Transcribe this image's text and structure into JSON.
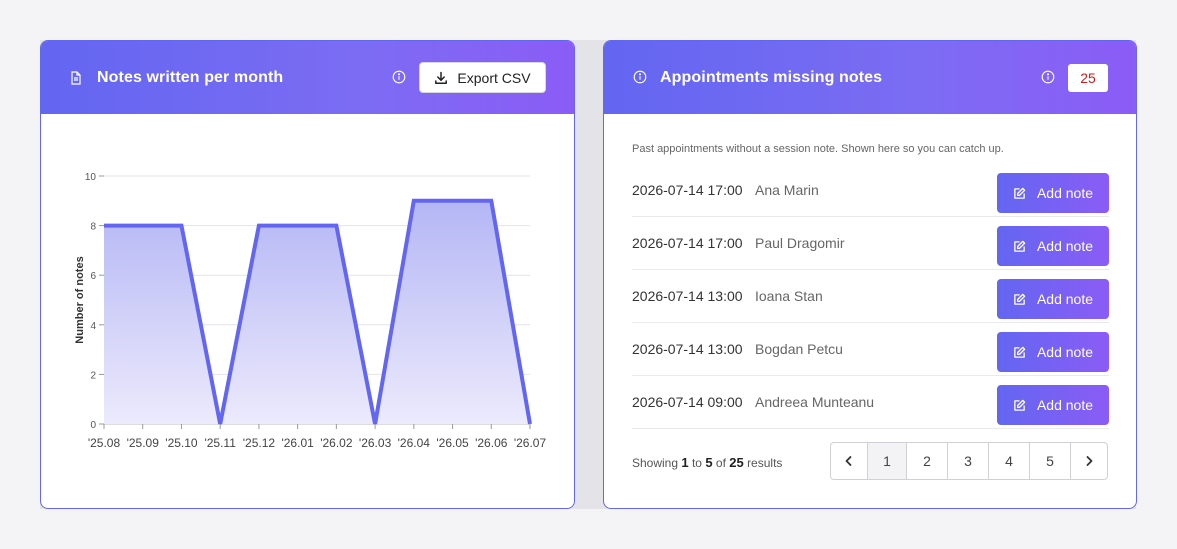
{
  "left_card": {
    "title": "Notes written per month",
    "export_label": "Export CSV"
  },
  "right_card": {
    "title": "Appointments missing notes",
    "count": "25",
    "subtitle": "Past appointments without a session note. Shown here so you can catch up.",
    "add_label": "Add note",
    "rows": [
      {
        "date": "2026-07-14 17:00",
        "name": "Ana Marin"
      },
      {
        "date": "2026-07-14 17:00",
        "name": "Paul Dragomir"
      },
      {
        "date": "2026-07-14 13:00",
        "name": "Ioana Stan"
      },
      {
        "date": "2026-07-14 13:00",
        "name": "Bogdan Petcu"
      },
      {
        "date": "2026-07-14 09:00",
        "name": "Andreea Munteanu"
      }
    ],
    "pagination": {
      "prefix": "Showing",
      "from": "1",
      "to_word": "to",
      "to": "5",
      "of_word": "of",
      "total": "25",
      "suffix": "results",
      "pages": [
        "1",
        "2",
        "3",
        "4",
        "5"
      ],
      "current": "1"
    }
  },
  "icons": {
    "document": "document-icon",
    "info": "info-icon",
    "download": "download-icon",
    "edit": "edit-icon",
    "prev": "chevron-left-icon",
    "next": "chevron-right-icon"
  },
  "colors": {
    "accent": "#6366f1",
    "accent_end": "#8b5cf6",
    "badge_text": "#c81e1e",
    "line": "#6366f1"
  },
  "chart_data": {
    "type": "area",
    "categories": [
      "'25.08",
      "'25.09",
      "'25.10",
      "'25.11",
      "'25.12",
      "'26.01",
      "'26.02",
      "'26.03",
      "'26.04",
      "'26.05",
      "'26.06",
      "'26.07"
    ],
    "series": [
      {
        "values": [
          8,
          8,
          8,
          0,
          8,
          8,
          8,
          0,
          9,
          9,
          9,
          0
        ]
      }
    ],
    "ylabel": "Number of notes",
    "ylim": [
      0,
      10
    ],
    "yticks": [
      0,
      2,
      4,
      6,
      8,
      10
    ],
    "grid": true
  }
}
